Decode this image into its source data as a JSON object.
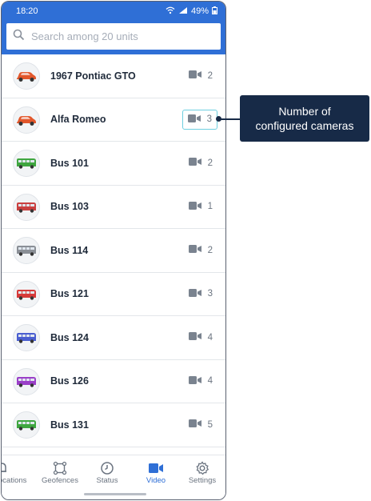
{
  "status": {
    "time": "18:20",
    "battery": "49%"
  },
  "search": {
    "placeholder": "Search among 20 units"
  },
  "units": [
    {
      "name": "1967 Pontiac GTO",
      "cameras": "2",
      "vehicle": "car",
      "color": "#e2572b"
    },
    {
      "name": "Alfa Romeo",
      "cameras": "3",
      "vehicle": "car",
      "color": "#e2572b"
    },
    {
      "name": "Bus 101",
      "cameras": "2",
      "vehicle": "bus",
      "color": "#3fa640"
    },
    {
      "name": "Bus 103",
      "cameras": "1",
      "vehicle": "bus",
      "color": "#c94040"
    },
    {
      "name": "Bus 114",
      "cameras": "2",
      "vehicle": "bus",
      "color": "#8a8f96"
    },
    {
      "name": "Bus 121",
      "cameras": "3",
      "vehicle": "bus",
      "color": "#d63a3a"
    },
    {
      "name": "Bus 124",
      "cameras": "4",
      "vehicle": "bus",
      "color": "#4a5ed0"
    },
    {
      "name": "Bus 126",
      "cameras": "4",
      "vehicle": "bus",
      "color": "#9a3fc8"
    },
    {
      "name": "Bus 131",
      "cameras": "5",
      "vehicle": "bus",
      "color": "#3fa640"
    }
  ],
  "nav": {
    "locations": "ocations",
    "geofences": "Geofences",
    "status": "Status",
    "video": "Video",
    "settings": "Settings"
  },
  "callout": {
    "line1": "Number of",
    "line2": "configured cameras"
  },
  "colors": {
    "accent": "#2f6fd6",
    "callout_bg": "#172a47",
    "highlight": "#6ecfe0"
  }
}
